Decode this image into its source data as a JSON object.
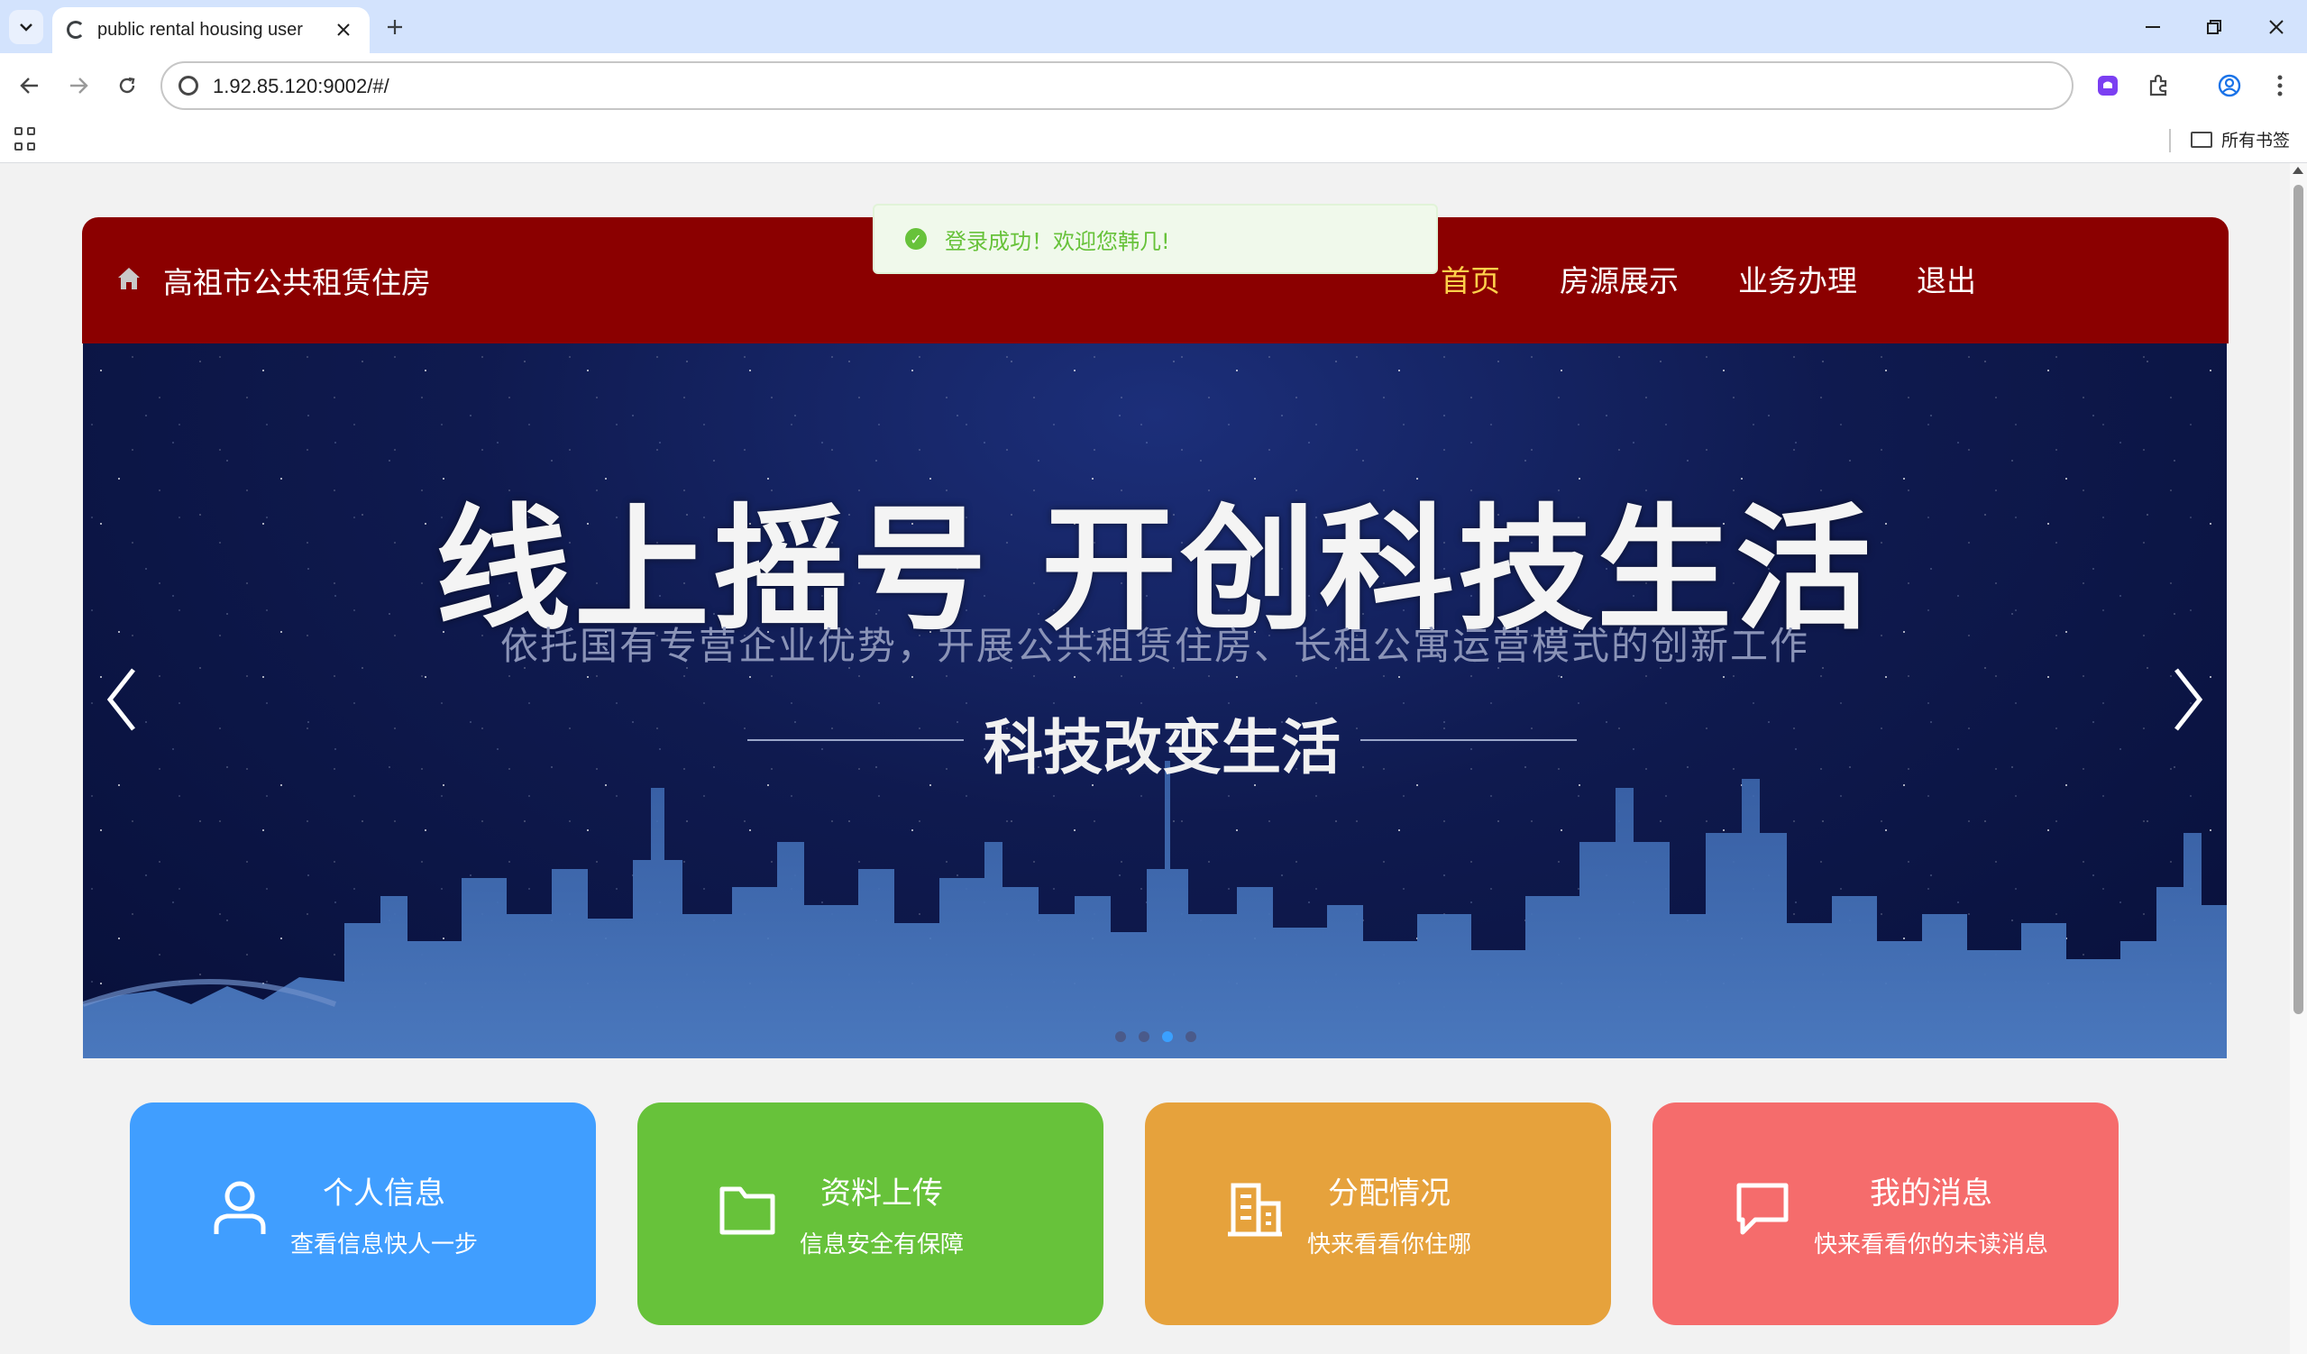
{
  "browser": {
    "tab_title": "public rental housing user",
    "url": "1.92.85.120:9002/#/",
    "bookmarks_folder": "所有书签"
  },
  "header": {
    "site_title": "高祖市公共租赁住房",
    "menu": [
      {
        "label": "首页",
        "active": true
      },
      {
        "label": "房源展示",
        "active": false
      },
      {
        "label": "业务办理",
        "active": false
      },
      {
        "label": "退出",
        "active": false
      }
    ],
    "colors": {
      "header_bg": "#8b0000",
      "active_menu": "#ffd04b"
    }
  },
  "toast": {
    "message": "登录成功！欢迎您韩几!",
    "type": "success"
  },
  "banner": {
    "headline": "线上摇号 开创科技生活",
    "subtitle": "依托国有专营企业优势，开展公共租赁住房、长租公寓运营模式的创新工作",
    "tagline": "科技改变生活",
    "indicator_count": 4,
    "active_indicator": 3
  },
  "features": [
    {
      "title": "个人信息",
      "desc": "查看信息快人一步",
      "icon": "user-icon",
      "color": "#409eff"
    },
    {
      "title": "资料上传",
      "desc": "信息安全有保障",
      "icon": "folder-icon",
      "color": "#67c23a"
    },
    {
      "title": "分配情况",
      "desc": "快来看看你住哪",
      "icon": "building-icon",
      "color": "#e6a23c"
    },
    {
      "title": "我的消息",
      "desc": "快来看看你的未读消息",
      "icon": "message-icon",
      "color": "#f56c6c"
    }
  ]
}
